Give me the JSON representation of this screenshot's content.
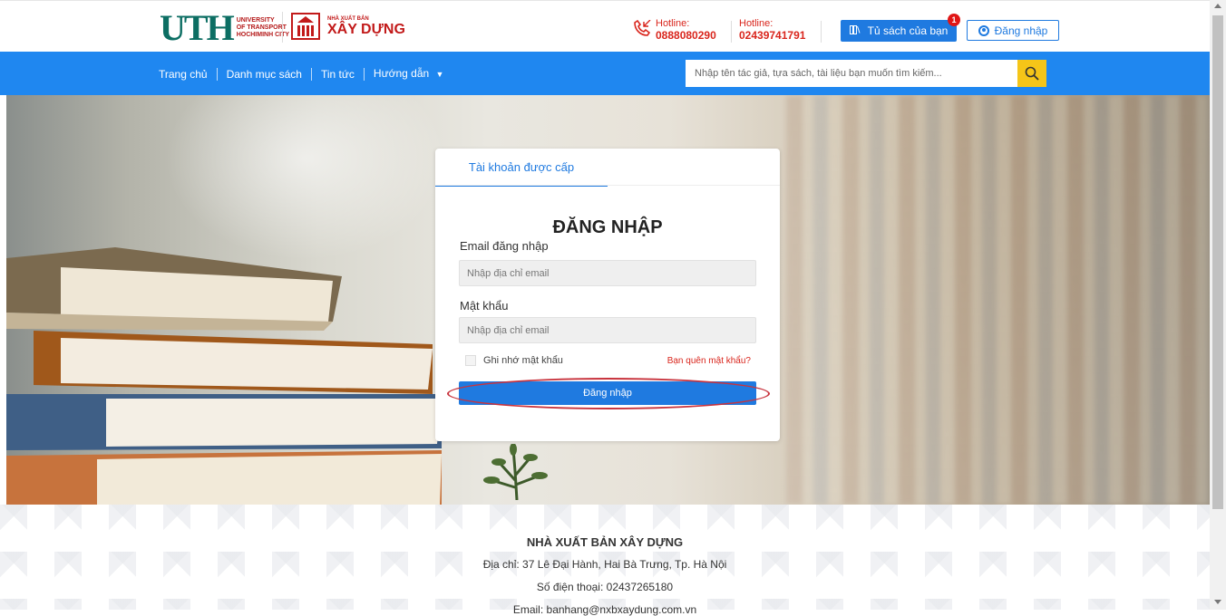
{
  "header": {
    "uth_logo": "UTH",
    "uth_sub": [
      "UNIVERSITY",
      "OF TRANSPORT",
      "HOCHIMINH CITY"
    ],
    "nxb_small": "NHÀ XUẤT BẢN",
    "nxb_big": "XÂY DỰNG",
    "hotline1_label": "Hotline:",
    "hotline1_number": "0888080290",
    "hotline2_label": "Hotline:",
    "hotline2_number": "02439741791",
    "shelf_button": "Tủ sách của bạn",
    "shelf_badge": "1",
    "login_button": "Đăng nhập"
  },
  "nav": {
    "items": [
      "Trang chủ",
      "Danh mục sách",
      "Tin tức",
      "Hướng dẫn"
    ],
    "search_placeholder": "Nhập tên tác giả, tựa sách, tài liệu bạn muốn tìm kiếm..."
  },
  "login_card": {
    "tab": "Tài khoản được cấp",
    "title": "ĐĂNG NHẬP",
    "email_label": "Email đăng nhập",
    "email_placeholder": "Nhập địa chỉ email",
    "password_label": "Mật khẩu",
    "password_placeholder": "Nhập địa chỉ email",
    "remember_label": "Ghi nhớ mật khẩu",
    "forgot_link": "Bạn quên mật khẩu?",
    "submit": "Đăng nhập"
  },
  "footer": {
    "title": "NHÀ XUẤT BẢN XÂY DỰNG",
    "address": "Địa chỉ: 37 Lê Đại Hành, Hai Bà Trưng, Tp. Hà Nội",
    "phone": "Số điện thoại: 02437265180",
    "email": "Email: banhang@nxbxaydung.com.vn"
  },
  "colors": {
    "primary": "#1f7ae0",
    "navbar": "#1f87f0",
    "search_button": "#f5c518",
    "hotline": "#d9251c",
    "highlight_ellipse": "#c8333d"
  },
  "icons": [
    "phone-icon",
    "book-icon",
    "user-circle-icon",
    "chevron-down-icon",
    "search-icon"
  ]
}
